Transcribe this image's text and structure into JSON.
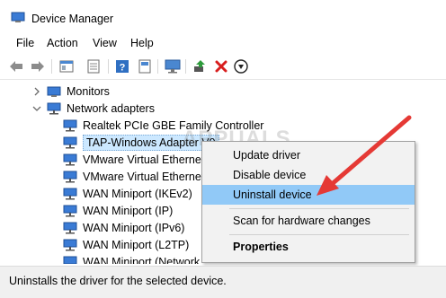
{
  "window": {
    "title": "Device Manager"
  },
  "menu": [
    "File",
    "Action",
    "View",
    "Help"
  ],
  "toolbar": {
    "icons": [
      "back-icon",
      "forward-icon",
      "show-hide-console-tree-icon",
      "properties-icon",
      "help-icon",
      "view-icon",
      "monitor-scan-icon",
      "update-driver-icon",
      "uninstall-icon",
      "download-icon"
    ]
  },
  "tree": {
    "monitors": "Monitors",
    "network_adapters": "Network adapters",
    "children": [
      "Realtek PCIe GBE Family Controller",
      "TAP-Windows Adapter V9",
      "VMware Virtual Ethernet A",
      "VMware Virtual Ethernet A",
      "WAN Miniport (IKEv2)",
      "WAN Miniport (IP)",
      "WAN Miniport (IPv6)",
      "WAN Miniport (L2TP)",
      "WAN Miniport (Network"
    ]
  },
  "context_menu": {
    "update_driver": "Update driver",
    "disable_device": "Disable device",
    "uninstall_device": "Uninstall device",
    "scan": "Scan for hardware changes",
    "properties": "Properties"
  },
  "watermark": "APPUALS",
  "status": "Uninstalls the driver for the selected device.",
  "colors": {
    "highlight": "#91c9f7",
    "arrow": "#e53935",
    "selection": "#cce8ff"
  }
}
